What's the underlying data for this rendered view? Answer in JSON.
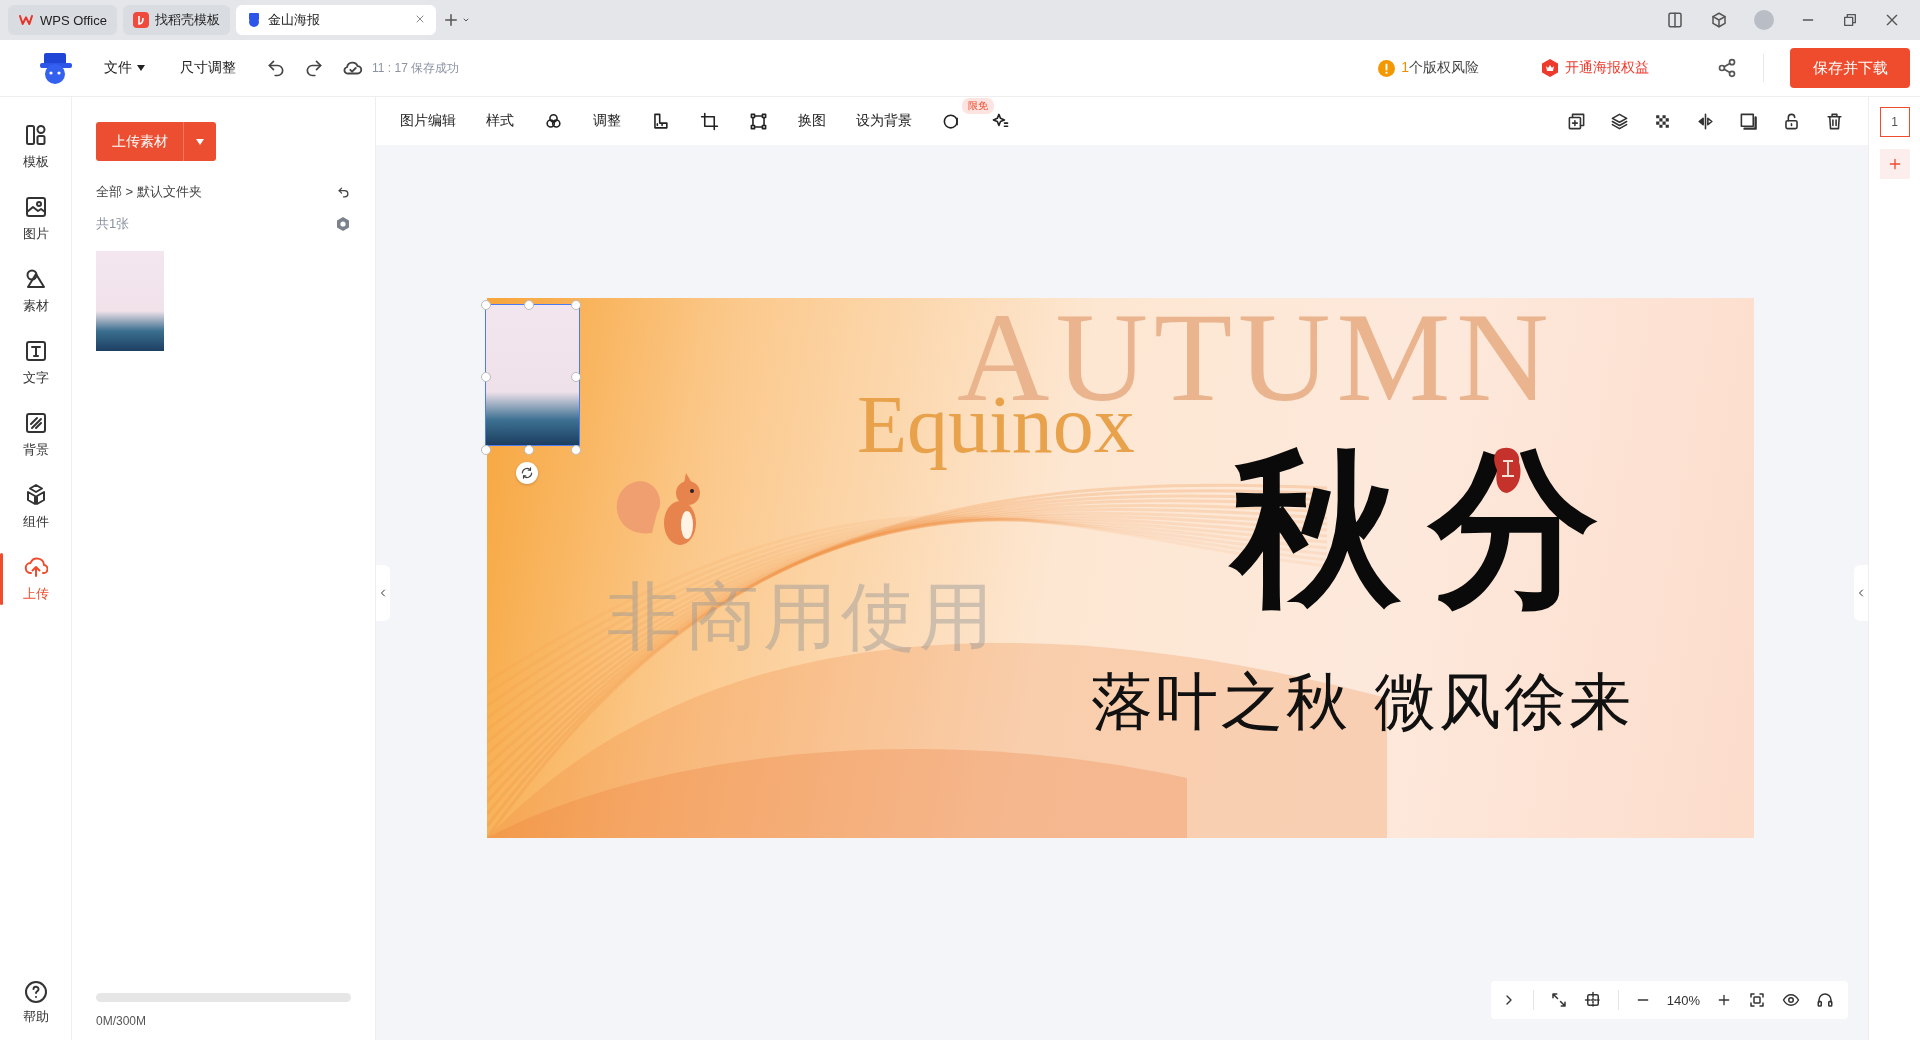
{
  "browser_tabs": [
    {
      "label": "WPS Office",
      "selected": false
    },
    {
      "label": "找稻壳模板",
      "selected": false
    },
    {
      "label": "金山海报",
      "selected": true
    }
  ],
  "header": {
    "menu": "文件",
    "resize": "尺寸调整",
    "save_status": "11 : 17 保存成功",
    "risk_count": "1",
    "risk_text": "个版权风险",
    "vip": "开通海报权益",
    "save_button": "保存并下载"
  },
  "rail": [
    {
      "label": "模板",
      "selected": false
    },
    {
      "label": "图片",
      "selected": false
    },
    {
      "label": "素材",
      "selected": false
    },
    {
      "label": "文字",
      "selected": false
    },
    {
      "label": "背景",
      "selected": false
    },
    {
      "label": "组件",
      "selected": false
    },
    {
      "label": "上传",
      "selected": true
    }
  ],
  "help": "帮助",
  "panel": {
    "upload_button": "上传素材",
    "breadcrumb": "全部 > 默认文件夹",
    "count": "共1张",
    "storage": {
      "level": 0,
      "reading": "0M/300M"
    }
  },
  "toolbar": [
    {
      "kind": "text",
      "label": "图片编辑"
    },
    {
      "kind": "text",
      "label": "样式"
    },
    {
      "kind": "icon"
    },
    {
      "kind": "text",
      "label": "调整"
    },
    {
      "kind": "icon"
    },
    {
      "kind": "icon"
    },
    {
      "kind": "icon"
    },
    {
      "kind": "text",
      "label": "换图"
    },
    {
      "kind": "text",
      "label": "设为背景"
    },
    {
      "kind": "icon",
      "badge": "限免"
    },
    {
      "kind": "icon"
    }
  ],
  "page_number": "1",
  "poster": {
    "bg_word": "AUTUMN",
    "en_title": "Equinox",
    "cn_title": "秋分",
    "subtitle": "落叶之秋 微风徐来",
    "watermark": "非商用使用"
  },
  "zoom": "140%"
}
